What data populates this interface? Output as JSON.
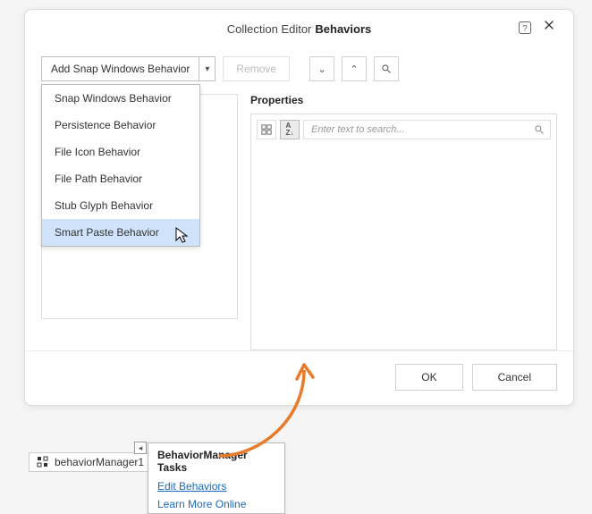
{
  "dialog": {
    "title_prefix": "Collection Editor",
    "title_bold": "Behaviors"
  },
  "toolbar": {
    "add_button": "Add Snap Windows Behavior",
    "remove_button": "Remove"
  },
  "dropdown_items": [
    "Snap Windows Behavior",
    "Persistence Behavior",
    "File Icon Behavior",
    "File Path Behavior",
    "Stub Glyph Behavior",
    "Smart Paste Behavior"
  ],
  "properties": {
    "header": "Properties",
    "search_placeholder": "Enter text to search..."
  },
  "footer": {
    "ok": "OK",
    "cancel": "Cancel"
  },
  "component": {
    "name": "behaviorManager1"
  },
  "tasks": {
    "title": "BehaviorManager Tasks",
    "link1": "Edit Behaviors",
    "link2": "Learn More Online"
  }
}
